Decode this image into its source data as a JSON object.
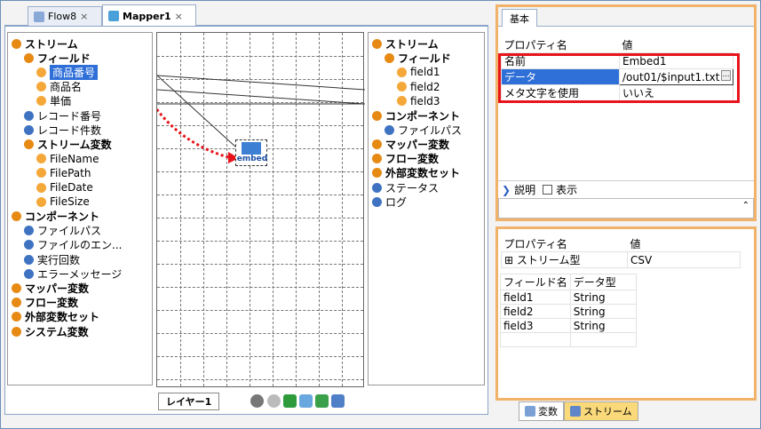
{
  "tabs": [
    {
      "label": "Flow8",
      "active": false
    },
    {
      "label": "Mapper1",
      "active": true
    }
  ],
  "left_tree": [
    {
      "label": "ストリーム",
      "bold": true,
      "level": 0
    },
    {
      "label": "フィールド",
      "bold": true,
      "level": 1
    },
    {
      "label": "商品番号",
      "level": 2,
      "selected": true
    },
    {
      "label": "商品名",
      "level": 2
    },
    {
      "label": "単価",
      "level": 2
    },
    {
      "label": "レコード番号",
      "level": 1
    },
    {
      "label": "レコード件数",
      "level": 1
    },
    {
      "label": "ストリーム変数",
      "bold": true,
      "level": 1
    },
    {
      "label": "FileName",
      "level": 2
    },
    {
      "label": "FilePath",
      "level": 2
    },
    {
      "label": "FileDate",
      "level": 2
    },
    {
      "label": "FileSize",
      "level": 2
    },
    {
      "label": "コンポーネント",
      "bold": true,
      "level": 0
    },
    {
      "label": "ファイルパス",
      "level": 1
    },
    {
      "label": "ファイルのエン...",
      "level": 1
    },
    {
      "label": "実行回数",
      "level": 1
    },
    {
      "label": "エラーメッセージ",
      "level": 1
    },
    {
      "label": "マッパー変数",
      "bold": true,
      "level": 0
    },
    {
      "label": "フロー変数",
      "bold": true,
      "level": 0
    },
    {
      "label": "外部変数セット",
      "bold": true,
      "level": 0
    },
    {
      "label": "システム変数",
      "bold": true,
      "level": 0
    }
  ],
  "right_tree": [
    {
      "label": "ストリーム",
      "bold": true
    },
    {
      "label": "フィールド",
      "bold": true
    },
    {
      "label": "field1"
    },
    {
      "label": "field2"
    },
    {
      "label": "field3"
    },
    {
      "label": "コンポーネント",
      "bold": true
    },
    {
      "label": "ファイルパス"
    },
    {
      "label": "マッパー変数",
      "bold": true
    },
    {
      "label": "フロー変数",
      "bold": true
    },
    {
      "label": "外部変数セット",
      "bold": true
    },
    {
      "label": "ステータス"
    },
    {
      "label": "ログ"
    }
  ],
  "canvas": {
    "component_label": "embed",
    "layer_tab": "レイヤー1"
  },
  "props_top": {
    "tab": "基本",
    "header": [
      "プロパティ名",
      "値"
    ],
    "rows": [
      [
        "名前",
        "Embed1"
      ],
      [
        "データ",
        "/out01/$input1.txt"
      ],
      [
        "メタ文字を使用",
        "いいえ"
      ]
    ],
    "desc_label": "説明",
    "show_label": "表示"
  },
  "props_bottom": {
    "header": [
      "プロパティ名",
      "値"
    ],
    "stream_row": [
      "ストリーム型",
      "CSV"
    ],
    "expand_symbol": "⊞",
    "field_header": [
      "フィールド名",
      "データ型"
    ],
    "fields": [
      [
        "field1",
        "String"
      ],
      [
        "field2",
        "String"
      ],
      [
        "field3",
        "String"
      ]
    ]
  },
  "bottom_tabs": [
    {
      "label": "変数",
      "active": false
    },
    {
      "label": "ストリーム",
      "active": true
    }
  ],
  "colors": {
    "selection": "#2f6fd8",
    "highlight": "#e8141b",
    "orange_frame": "#f2b26a",
    "arrow": "#e8141b"
  }
}
